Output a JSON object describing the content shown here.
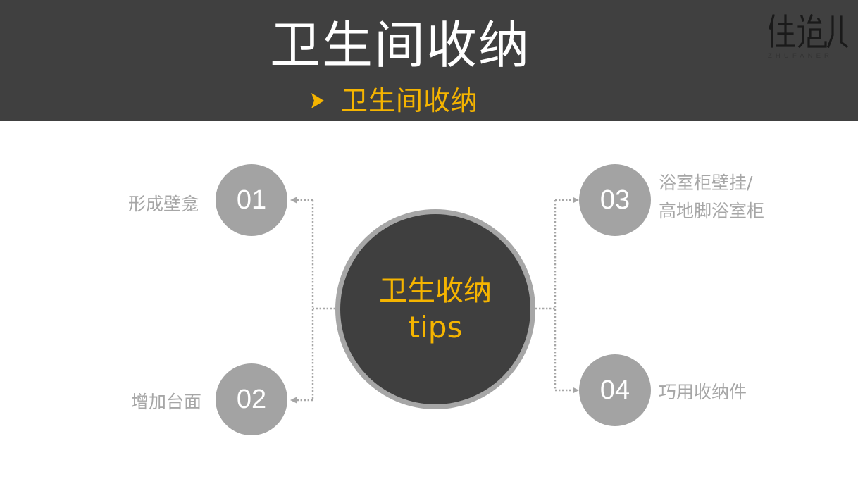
{
  "header": {
    "title": "卫生间收纳",
    "subtitle": "卫生间收纳",
    "bullet_icon": "arrow-right-icon",
    "logo_text": "ZHUFANER"
  },
  "center": {
    "line1": "卫生收纳",
    "line2": "tips"
  },
  "items": [
    {
      "number": "01",
      "label": "形成壁龛"
    },
    {
      "number": "02",
      "label": "增加台面"
    },
    {
      "number": "03",
      "label_line1": "浴室柜壁挂/",
      "label_line2": "高地脚浴室柜"
    },
    {
      "number": "04",
      "label": "巧用收纳件"
    }
  ],
  "colors": {
    "header_bg": "#404040",
    "accent": "#f5b400",
    "node": "#a3a3a3",
    "center_fill": "#3f3f3f",
    "label": "#a6a6a6"
  }
}
